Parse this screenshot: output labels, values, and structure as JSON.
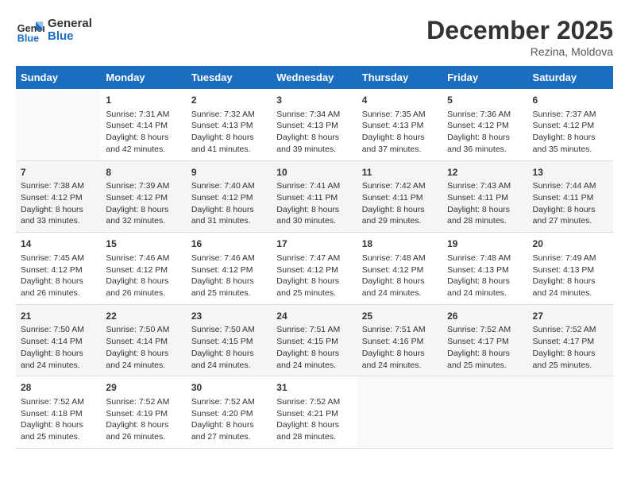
{
  "header": {
    "logo_line1": "General",
    "logo_line2": "Blue",
    "month": "December 2025",
    "location": "Rezina, Moldova"
  },
  "weekdays": [
    "Sunday",
    "Monday",
    "Tuesday",
    "Wednesday",
    "Thursday",
    "Friday",
    "Saturday"
  ],
  "weeks": [
    [
      {
        "day": "",
        "data": ""
      },
      {
        "day": "1",
        "data": "Sunrise: 7:31 AM\nSunset: 4:14 PM\nDaylight: 8 hours and 42 minutes."
      },
      {
        "day": "2",
        "data": "Sunrise: 7:32 AM\nSunset: 4:13 PM\nDaylight: 8 hours and 41 minutes."
      },
      {
        "day": "3",
        "data": "Sunrise: 7:34 AM\nSunset: 4:13 PM\nDaylight: 8 hours and 39 minutes."
      },
      {
        "day": "4",
        "data": "Sunrise: 7:35 AM\nSunset: 4:13 PM\nDaylight: 8 hours and 37 minutes."
      },
      {
        "day": "5",
        "data": "Sunrise: 7:36 AM\nSunset: 4:12 PM\nDaylight: 8 hours and 36 minutes."
      },
      {
        "day": "6",
        "data": "Sunrise: 7:37 AM\nSunset: 4:12 PM\nDaylight: 8 hours and 35 minutes."
      }
    ],
    [
      {
        "day": "7",
        "data": "Sunrise: 7:38 AM\nSunset: 4:12 PM\nDaylight: 8 hours and 33 minutes."
      },
      {
        "day": "8",
        "data": "Sunrise: 7:39 AM\nSunset: 4:12 PM\nDaylight: 8 hours and 32 minutes."
      },
      {
        "day": "9",
        "data": "Sunrise: 7:40 AM\nSunset: 4:12 PM\nDaylight: 8 hours and 31 minutes."
      },
      {
        "day": "10",
        "data": "Sunrise: 7:41 AM\nSunset: 4:11 PM\nDaylight: 8 hours and 30 minutes."
      },
      {
        "day": "11",
        "data": "Sunrise: 7:42 AM\nSunset: 4:11 PM\nDaylight: 8 hours and 29 minutes."
      },
      {
        "day": "12",
        "data": "Sunrise: 7:43 AM\nSunset: 4:11 PM\nDaylight: 8 hours and 28 minutes."
      },
      {
        "day": "13",
        "data": "Sunrise: 7:44 AM\nSunset: 4:11 PM\nDaylight: 8 hours and 27 minutes."
      }
    ],
    [
      {
        "day": "14",
        "data": "Sunrise: 7:45 AM\nSunset: 4:12 PM\nDaylight: 8 hours and 26 minutes."
      },
      {
        "day": "15",
        "data": "Sunrise: 7:46 AM\nSunset: 4:12 PM\nDaylight: 8 hours and 26 minutes."
      },
      {
        "day": "16",
        "data": "Sunrise: 7:46 AM\nSunset: 4:12 PM\nDaylight: 8 hours and 25 minutes."
      },
      {
        "day": "17",
        "data": "Sunrise: 7:47 AM\nSunset: 4:12 PM\nDaylight: 8 hours and 25 minutes."
      },
      {
        "day": "18",
        "data": "Sunrise: 7:48 AM\nSunset: 4:12 PM\nDaylight: 8 hours and 24 minutes."
      },
      {
        "day": "19",
        "data": "Sunrise: 7:48 AM\nSunset: 4:13 PM\nDaylight: 8 hours and 24 minutes."
      },
      {
        "day": "20",
        "data": "Sunrise: 7:49 AM\nSunset: 4:13 PM\nDaylight: 8 hours and 24 minutes."
      }
    ],
    [
      {
        "day": "21",
        "data": "Sunrise: 7:50 AM\nSunset: 4:14 PM\nDaylight: 8 hours and 24 minutes."
      },
      {
        "day": "22",
        "data": "Sunrise: 7:50 AM\nSunset: 4:14 PM\nDaylight: 8 hours and 24 minutes."
      },
      {
        "day": "23",
        "data": "Sunrise: 7:50 AM\nSunset: 4:15 PM\nDaylight: 8 hours and 24 minutes."
      },
      {
        "day": "24",
        "data": "Sunrise: 7:51 AM\nSunset: 4:15 PM\nDaylight: 8 hours and 24 minutes."
      },
      {
        "day": "25",
        "data": "Sunrise: 7:51 AM\nSunset: 4:16 PM\nDaylight: 8 hours and 24 minutes."
      },
      {
        "day": "26",
        "data": "Sunrise: 7:52 AM\nSunset: 4:17 PM\nDaylight: 8 hours and 25 minutes."
      },
      {
        "day": "27",
        "data": "Sunrise: 7:52 AM\nSunset: 4:17 PM\nDaylight: 8 hours and 25 minutes."
      }
    ],
    [
      {
        "day": "28",
        "data": "Sunrise: 7:52 AM\nSunset: 4:18 PM\nDaylight: 8 hours and 25 minutes."
      },
      {
        "day": "29",
        "data": "Sunrise: 7:52 AM\nSunset: 4:19 PM\nDaylight: 8 hours and 26 minutes."
      },
      {
        "day": "30",
        "data": "Sunrise: 7:52 AM\nSunset: 4:20 PM\nDaylight: 8 hours and 27 minutes."
      },
      {
        "day": "31",
        "data": "Sunrise: 7:52 AM\nSunset: 4:21 PM\nDaylight: 8 hours and 28 minutes."
      },
      {
        "day": "",
        "data": ""
      },
      {
        "day": "",
        "data": ""
      },
      {
        "day": "",
        "data": ""
      }
    ]
  ]
}
